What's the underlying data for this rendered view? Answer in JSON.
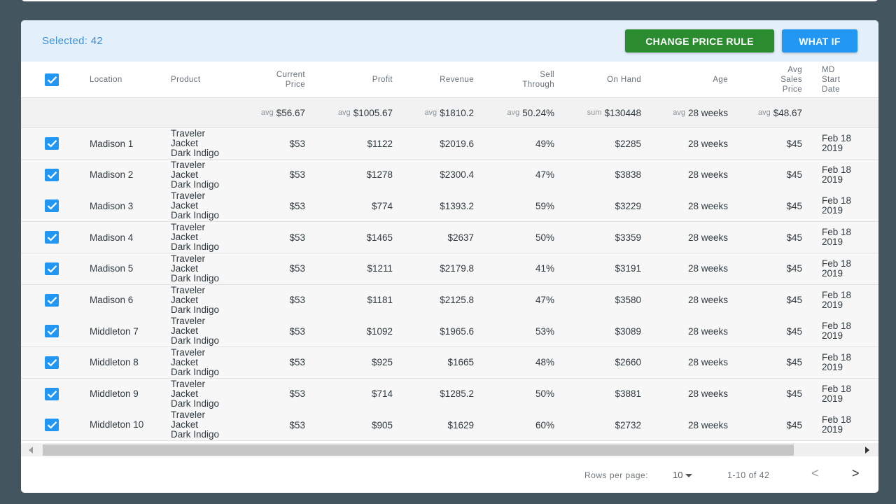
{
  "toolbar": {
    "selected_text": "Selected: 42",
    "change_price_label": "CHANGE PRICE RULE",
    "what_if_label": "WHAT IF"
  },
  "colors": {
    "accent": "#2196f3",
    "primary_green": "#2a8c2f",
    "background": "#435660"
  },
  "columns": {
    "location": [
      "Location"
    ],
    "product": [
      "Product"
    ],
    "price": [
      "Current",
      "Price"
    ],
    "profit": [
      "Profit"
    ],
    "revenue": [
      "Revenue"
    ],
    "sell": [
      "Sell",
      "Through"
    ],
    "onhand": [
      "On Hand"
    ],
    "age": [
      "Age"
    ],
    "avgsales": [
      "Avg",
      "Sales",
      "Price"
    ],
    "md": [
      "MD",
      "Start",
      "Date"
    ]
  },
  "summary": {
    "price": {
      "agg": "avg",
      "value": "$56.67"
    },
    "profit": {
      "agg": "avg",
      "value": "$1005.67"
    },
    "revenue": {
      "agg": "avg",
      "value": "$1810.2"
    },
    "sell": {
      "agg": "avg",
      "value": "50.24%"
    },
    "onhand": {
      "agg": "sum",
      "value": "$130448"
    },
    "age": {
      "agg": "avg",
      "value": "28 weeks"
    },
    "avgsales": {
      "agg": "avg",
      "value": "$48.67"
    }
  },
  "rows": [
    {
      "location": "Madison 1",
      "product": [
        "Traveler",
        "Jacket",
        "Dark Indigo"
      ],
      "price": "$53",
      "profit": "$1122",
      "revenue": "$2019.6",
      "sell": "49%",
      "onhand": "$2285",
      "age": "28 weeks",
      "avgsales": "$45",
      "md": [
        "Feb 18",
        "2019"
      ]
    },
    {
      "location": "Madison 2",
      "product": [
        "Traveler",
        "Jacket",
        "Dark Indigo"
      ],
      "price": "$53",
      "profit": "$1278",
      "revenue": "$2300.4",
      "sell": "47%",
      "onhand": "$3838",
      "age": "28 weeks",
      "avgsales": "$45",
      "md": [
        "Feb 18",
        "2019"
      ]
    },
    {
      "location": "Madison 3",
      "product": [
        "Traveler",
        "Jacket",
        "Dark Indigo"
      ],
      "price": "$53",
      "profit": "$774",
      "revenue": "$1393.2",
      "sell": "59%",
      "onhand": "$3229",
      "age": "28 weeks",
      "avgsales": "$45",
      "md": [
        "Feb 18",
        "2019"
      ]
    },
    {
      "location": "Madison 4",
      "product": [
        "Traveler",
        "Jacket",
        "Dark Indigo"
      ],
      "price": "$53",
      "profit": "$1465",
      "revenue": "$2637",
      "sell": "50%",
      "onhand": "$3359",
      "age": "28 weeks",
      "avgsales": "$45",
      "md": [
        "Feb 18",
        "2019"
      ]
    },
    {
      "location": "Madison 5",
      "product": [
        "Traveler",
        "Jacket",
        "Dark Indigo"
      ],
      "price": "$53",
      "profit": "$1211",
      "revenue": "$2179.8",
      "sell": "41%",
      "onhand": "$3191",
      "age": "28 weeks",
      "avgsales": "$45",
      "md": [
        "Feb 18",
        "2019"
      ]
    },
    {
      "location": "Madison 6",
      "product": [
        "Traveler",
        "Jacket",
        "Dark Indigo"
      ],
      "price": "$53",
      "profit": "$1181",
      "revenue": "$2125.8",
      "sell": "47%",
      "onhand": "$3580",
      "age": "28 weeks",
      "avgsales": "$45",
      "md": [
        "Feb 18",
        "2019"
      ]
    },
    {
      "location": "Middleton 7",
      "product": [
        "Traveler",
        "Jacket",
        "Dark Indigo"
      ],
      "price": "$53",
      "profit": "$1092",
      "revenue": "$1965.6",
      "sell": "53%",
      "onhand": "$3089",
      "age": "28 weeks",
      "avgsales": "$45",
      "md": [
        "Feb 18",
        "2019"
      ]
    },
    {
      "location": "Middleton 8",
      "product": [
        "Traveler",
        "Jacket",
        "Dark Indigo"
      ],
      "price": "$53",
      "profit": "$925",
      "revenue": "$1665",
      "sell": "48%",
      "onhand": "$2660",
      "age": "28 weeks",
      "avgsales": "$45",
      "md": [
        "Feb 18",
        "2019"
      ]
    },
    {
      "location": "Middleton 9",
      "product": [
        "Traveler",
        "Jacket",
        "Dark Indigo"
      ],
      "price": "$53",
      "profit": "$714",
      "revenue": "$1285.2",
      "sell": "50%",
      "onhand": "$3881",
      "age": "28 weeks",
      "avgsales": "$45",
      "md": [
        "Feb 18",
        "2019"
      ]
    },
    {
      "location": "Middleton 10",
      "product": [
        "Traveler",
        "Jacket",
        "Dark Indigo"
      ],
      "price": "$53",
      "profit": "$905",
      "revenue": "$1629",
      "sell": "60%",
      "onhand": "$2732",
      "age": "28 weeks",
      "avgsales": "$45",
      "md": [
        "Feb 18",
        "2019"
      ]
    }
  ],
  "footer": {
    "rows_per_page_label": "Rows per page:",
    "rows_per_page_value": "10",
    "range_text": "1-10 of 42",
    "prev_icon": "chevron-left-icon",
    "next_icon": "chevron-right-icon",
    "prev_glyph": "<",
    "next_glyph": ">"
  }
}
